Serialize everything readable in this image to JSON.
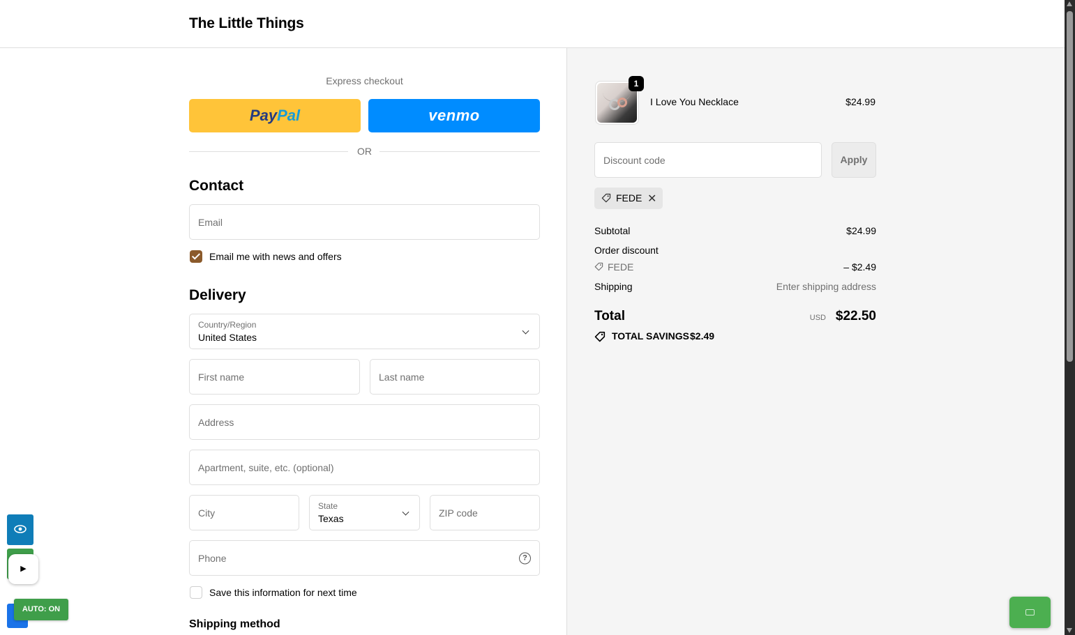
{
  "header": {
    "store_name": "The Little Things"
  },
  "express": {
    "title": "Express checkout",
    "paypal_part1": "Pay",
    "paypal_part2": "Pal",
    "venmo_label": "venmo",
    "or_label": "OR"
  },
  "contact": {
    "heading": "Contact",
    "email_placeholder": "Email",
    "news_checkbox_label": "Email me with news and offers",
    "news_checked": true
  },
  "delivery": {
    "heading": "Delivery",
    "country_label": "Country/Region",
    "country_value": "United States",
    "first_name_placeholder": "First name",
    "last_name_placeholder": "Last name",
    "address_placeholder": "Address",
    "apartment_placeholder": "Apartment, suite, etc. (optional)",
    "city_placeholder": "City",
    "state_label": "State",
    "state_value": "Texas",
    "zip_placeholder": "ZIP code",
    "phone_placeholder": "Phone",
    "help_icon": "?",
    "save_info_label": "Save this information for next time",
    "save_info_checked": false
  },
  "shipping_method": {
    "heading": "Shipping method"
  },
  "order": {
    "item": {
      "name": "I Love You Necklace",
      "price": "$24.99",
      "quantity": "1"
    },
    "discount_placeholder": "Discount code",
    "apply_label": "Apply",
    "applied_code": "FEDE",
    "remove_symbol": "✕",
    "subtotal_label": "Subtotal",
    "subtotal_value": "$24.99",
    "order_discount_label": "Order discount",
    "discount_code_label": "FEDE",
    "discount_value": "– $2.49",
    "shipping_label": "Shipping",
    "shipping_value": "Enter shipping address",
    "total_label": "Total",
    "currency": "USD",
    "total_value": "$22.50",
    "savings_label": "TOTAL SAVINGS",
    "savings_value": "$2.49"
  },
  "overlay": {
    "play_symbol": "▶",
    "auto_label": "AUTO: ON"
  },
  "colors": {
    "paypal": "#ffc439",
    "venmo": "#008cff",
    "checkbox_accent": "#8b5a2b",
    "sidebar_bg": "#f5f5f5"
  }
}
